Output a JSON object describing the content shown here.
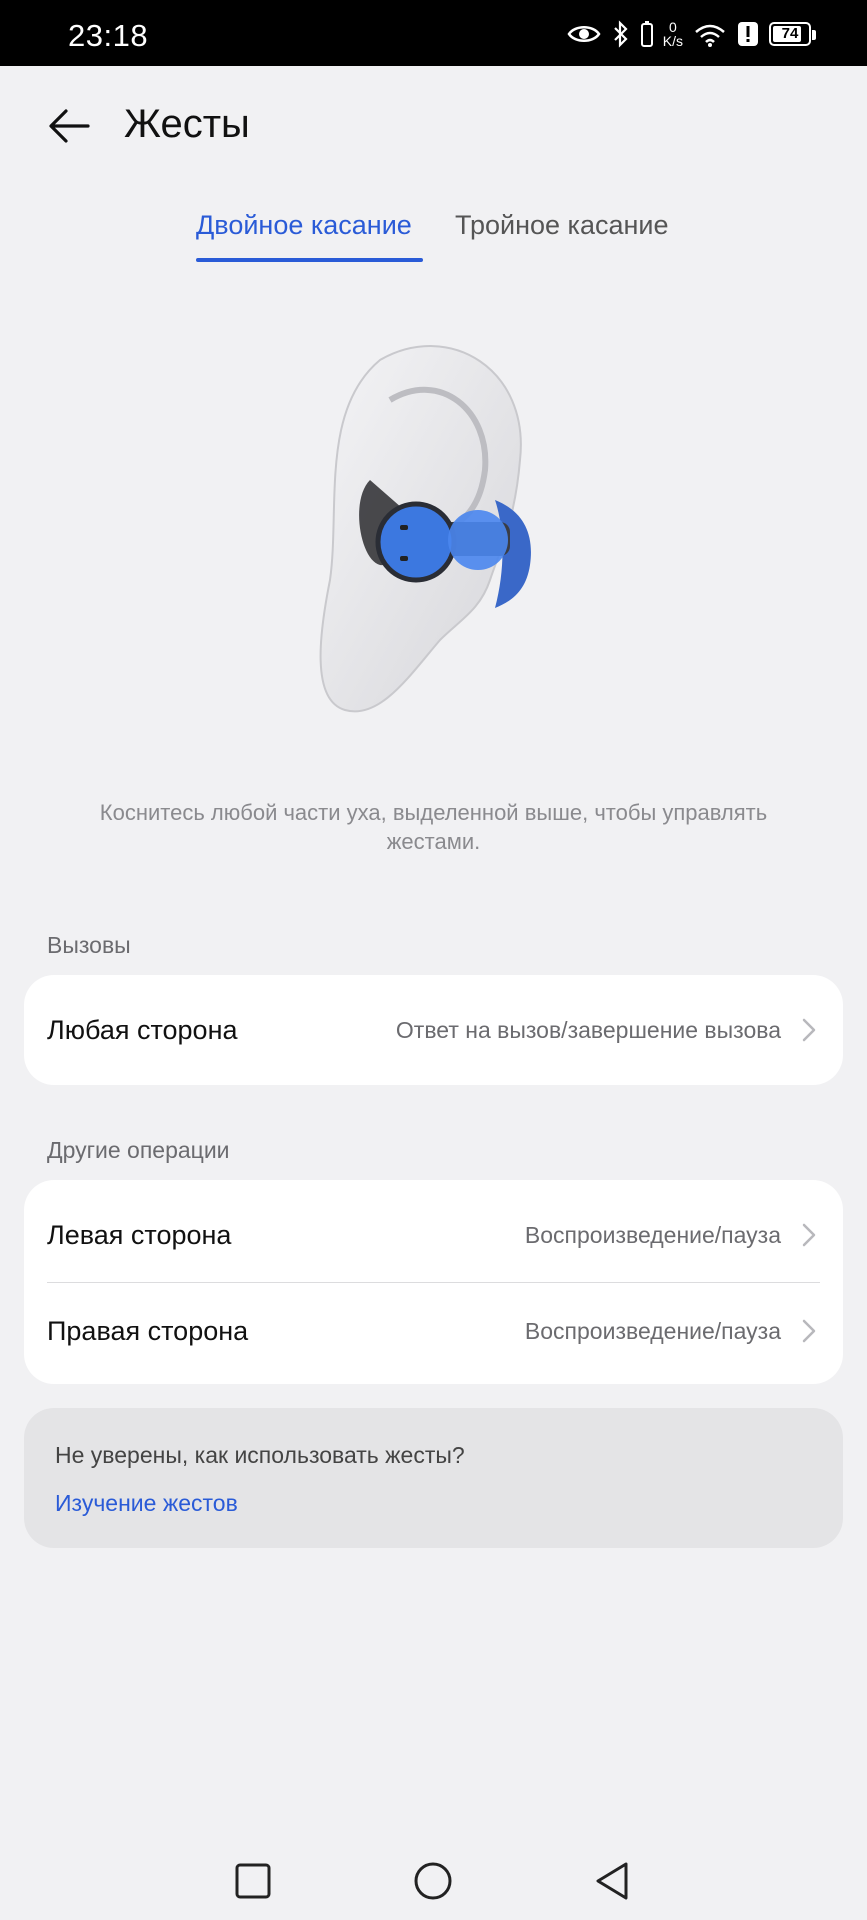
{
  "status_bar": {
    "time": "23:18",
    "net_speed_value": "0",
    "net_speed_unit": "K/s",
    "battery": "74",
    "icons": [
      "eye-icon",
      "bluetooth-icon",
      "net-speed",
      "wifi-icon",
      "alert-icon",
      "battery-icon"
    ]
  },
  "header": {
    "title": "Жесты"
  },
  "tabs": [
    {
      "label": "Двойное касание",
      "active": true
    },
    {
      "label": "Тройное касание",
      "active": false
    }
  ],
  "illustration": {
    "accent_color": "#3c78e0"
  },
  "hint": "Коснитесь любой части уха, выделенной выше, чтобы управлять жестами.",
  "calls": {
    "section_title": "Вызовы",
    "rows": [
      {
        "label": "Любая сторона",
        "value": "Ответ на вызов/завершение вызова"
      }
    ]
  },
  "other": {
    "section_title": "Другие операции",
    "rows": [
      {
        "label": "Левая сторона",
        "value": "Воспроизведение/пауза"
      },
      {
        "label": "Правая сторона",
        "value": "Воспроизведение/пауза"
      }
    ]
  },
  "help": {
    "question": "Не уверены, как использовать жесты?",
    "link": "Изучение жестов"
  },
  "colors": {
    "accent": "#2a5bd7",
    "background": "#f1f1f3",
    "card": "#ffffff"
  }
}
